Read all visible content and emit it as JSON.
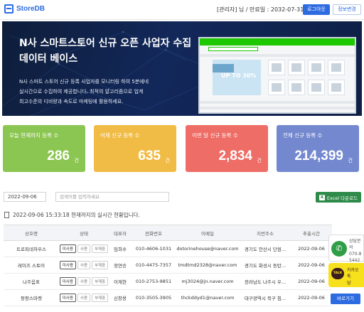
{
  "header": {
    "logo_text": "StoreDB",
    "user_info": "[관리자] 님 / 만료일 : 2032-07-31",
    "logout_label": "로그아웃",
    "profile_label": "정보변경"
  },
  "hero": {
    "title_line1": "N사 스마트스토어 신규 오픈 사업자 수집",
    "title_line2": "데이터 베이스",
    "desc_line1": "N사 스마트 스토어 신규 등록 사업자를 모니터링 하여 5분에네",
    "desc_line2": "실시간으로 수집하여 제공합니다. 최적의 알고리즘으로 업계",
    "desc_line3": "최고수준의 디비량과 속도로 마케팅에 활용하세요.",
    "shot_sale": "UP TO 30%"
  },
  "stats": [
    {
      "label": "오늘 현재까지 등록 수",
      "value": "286",
      "unit": "건",
      "color": "#8cc652"
    },
    {
      "label": "어제 신규 등록 수",
      "value": "635",
      "unit": "건",
      "color": "#f1bc45"
    },
    {
      "label": "이번 달 신규 등록 수",
      "value": "2,834",
      "unit": "건",
      "color": "#ee6d66"
    },
    {
      "label": "전체 신규 등록 수",
      "value": "214,399",
      "unit": "건",
      "color": "#7488cf"
    }
  ],
  "filter": {
    "date_value": "2022-09-06",
    "search_placeholder": "검색어를 입력하세요",
    "excel_label": "Excel 다운로드",
    "status_text": "2022-09-06 15:33:18 현재까지의 실시간 현황입니다."
  },
  "table": {
    "headers": [
      "상호명",
      "상태",
      "대표자",
      "전화번호",
      "이메일",
      "지번주소",
      "추출시간"
    ],
    "status_labels": [
      "미사용",
      "사용",
      "부재중"
    ],
    "rows": [
      {
        "name": "트로피네하우스",
        "owner": "임희수",
        "phone": "010-4606-1031",
        "email": "dotorinehouse@naver.com",
        "address": "경기도 안산시 단원...",
        "time": "2022-09-06"
      },
      {
        "name": "레이즈 스토어",
        "owner": "정연승",
        "phone": "010-4475-7357",
        "email": "tmdtmd2328@naver.com",
        "address": "경기도 화성시 동탄...",
        "time": "2022-09-06"
      },
      {
        "name": "나주음표",
        "owner": "이재현",
        "phone": "010-2753-9851",
        "email": "mj3024@jn.naver.com",
        "address": "전라남도 나주시 우...",
        "time": "2022-09-06"
      },
      {
        "name": "팡팡스마켓",
        "owner": "신창용",
        "phone": "010-3505-3905",
        "email": "thckddyd1@naver.com",
        "address": "대구광역시 북구 침...",
        "time": "2022-09-06"
      }
    ]
  },
  "widgets": {
    "call_line1": "상담문의",
    "call_line2": "070-8",
    "call_line3": "5442",
    "kakao_label": "TALK",
    "kakao_line1": "카카오",
    "kakao_line2": "톡",
    "kakao_line3": "담",
    "shortcut_label": "바로가기"
  }
}
